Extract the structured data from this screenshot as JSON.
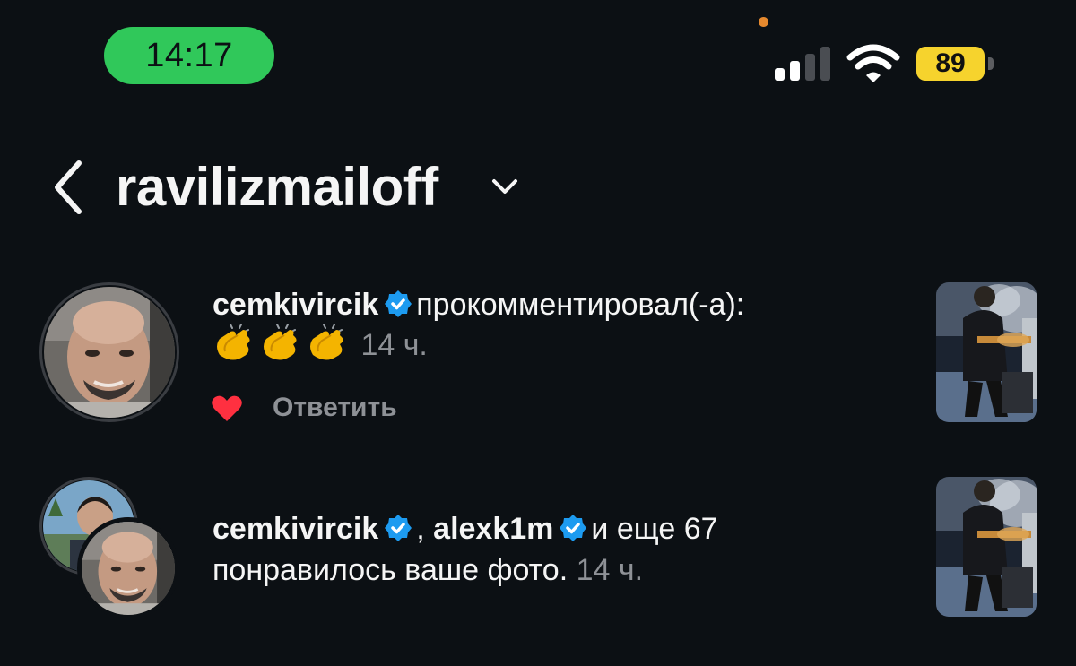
{
  "status_bar": {
    "time": "14:17",
    "battery_percent": "89",
    "signal_bars_active": 2,
    "signal_bars_total": 4,
    "icons": [
      "signal-icon",
      "wifi-icon",
      "battery-icon"
    ]
  },
  "header": {
    "title": "ravilizmailoff",
    "back_icon": "chevron-left-icon",
    "dropdown_icon": "chevron-down-icon"
  },
  "notifications": [
    {
      "type": "comment",
      "username": "cemkivircik",
      "verified": true,
      "action": "прокомментировал(-а):",
      "comment_emoji": "👏👏👏",
      "emoji_count": 3,
      "time": "14 ч.",
      "liked": true,
      "reply_label": "Ответить"
    },
    {
      "type": "likes",
      "username_1": "cemkivircik",
      "username_2": "alexk1m",
      "separator": ",",
      "others": "и еще 67",
      "action": "понравилось ваше фото.",
      "time": "14 ч."
    }
  ],
  "colors": {
    "background": "#0c1014",
    "text": "#f5f5f5",
    "muted": "#8e9196",
    "time_pill": "#30c85a",
    "battery": "#f6d32d",
    "verified": "#1d9bf0",
    "heart": "#ff3040"
  }
}
